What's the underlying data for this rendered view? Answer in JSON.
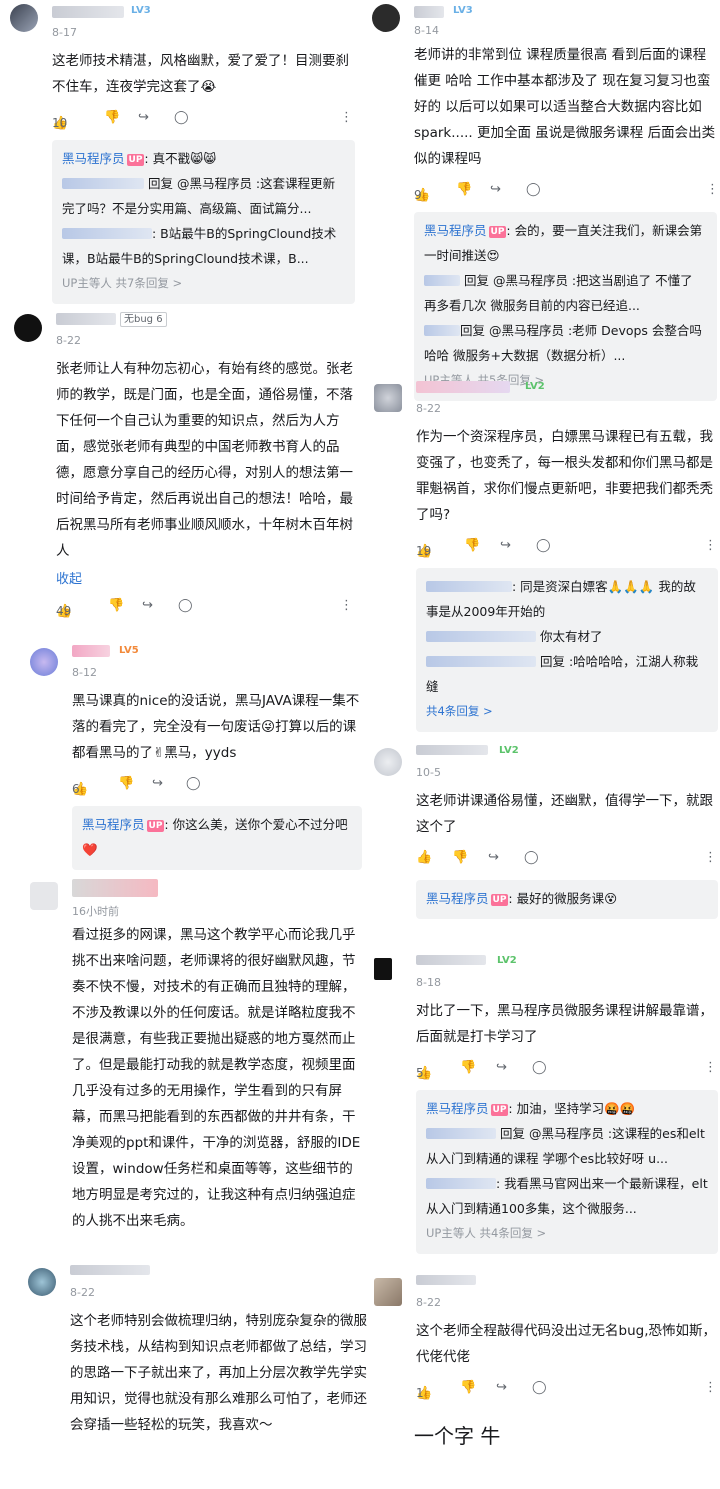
{
  "comments": [
    {
      "date": "8-17",
      "level": "LV3",
      "text": "这老师技术精湛，风格幽默，爱了爱了！目测要刹不住车，连夜学完这套了😭",
      "likes": "10",
      "replies": [
        {
          "who": "黑马程序员",
          "up": "UP",
          "text": ": 真不戳😸😸"
        },
        {
          "who": "",
          "text": "回复 @黑马程序员 :这套课程更新完了吗？不是分实用篇、高级篇、面试篇分..."
        },
        {
          "who": "",
          "text": ": B站最牛B的SpringClound技术课，B站最牛B的SpringClound技术课，B..."
        }
      ],
      "more": "UP主等人 共7条回复 >"
    },
    {
      "date": "8-22",
      "badge": "无bug 6",
      "text": "张老师让人有种勿忘初心，有始有终的感觉。张老师的教学，既是门面，也是全面，通俗易懂，不落下任何一个自己认为重要的知识点，然后为人方面，感觉张老师有典型的中国老师教书育人的品德，愿意分享自己的经历心得，对别人的想法第一时间给予肯定，然后再说出自己的想法！哈哈，最后祝黑马所有老师事业顺风顺水，十年树木百年树人",
      "collapse": "收起",
      "likes": "49"
    },
    {
      "date": "8-12",
      "level": "LV5",
      "text": "黑马课真的nice的没话说，黑马JAVA课程一集不落的看完了，完全没有一句废话😜打算以后的课都看黑马的了✌黑马，yyds",
      "likes": "6",
      "replies": [
        {
          "who": "黑马程序员",
          "up": "UP",
          "text": ": 你这么美，送你个爱心不过分吧❤️"
        }
      ]
    },
    {
      "date": "16小时前",
      "text": "看过挺多的网课，黑马这个教学平心而论我几乎挑不出来啥问题，老师课将的很好幽默风趣，节奏不快不慢，对技术的有正确而且独特的理解，不涉及教课以外的任何废话。就是详略粒度我不是很满意，有些我正要抛出疑惑的地方戛然而止了。但是最能打动我的就是教学态度，视频里面几乎没有过多的无用操作，学生看到的只有屏幕，而黑马把能看到的东西都做的井井有条，干净美观的ppt和课件，干净的浏览器，舒服的IDE设置，window任务栏和桌面等等，这些细节的地方明显是考究过的，让我这种有点归纳强迫症的人挑不出来毛病。"
    },
    {
      "date": "8-22",
      "text": "这个老师特别会做梳理归纳，特别庞杂复杂的微服务技术栈，从结构到知识点老师都做了总结，学习的思路一下子就出来了，再加上分层次教学先学实用知识，觉得也就没有那么难那么可怕了，老师还会穿插一些轻松的玩笑，我喜欢～"
    },
    {
      "date": "8-14",
      "level": "LV3",
      "text": "老师讲的非常到位 课程质量很高 看到后面的课程 催更 哈哈 工作中基本都涉及了 现在复习复习也蛮好的 以后可以如果可以适当整合大数据内容比如 spark..... 更加全面 虽说是微服务课程 后面会出类似的课程吗",
      "likes": "9",
      "replies": [
        {
          "who": "黑马程序员",
          "up": "UP",
          "text": ": 会的，要一直关注我们，新课会第一时间推送😍"
        },
        {
          "who": "",
          "text": "回复 @黑马程序员 :把这当剧追了 不懂了 再多看几次 微服务目前的内容已经追..."
        },
        {
          "who": "",
          "text": "回复 @黑马程序员 :老师 Devops 会整合吗 哈哈 微服务+大数据（数据分析）..."
        }
      ],
      "more": "UP主等人 共5条回复 >"
    },
    {
      "date": "8-22",
      "level": "LV2",
      "text": "作为一个资深程序员，白嫖黑马课程已有五载，我变强了，也变秃了，每一根头发都和你们黑马都是罪魁祸首，求你们慢点更新吧，非要把我们都秃秃了吗?",
      "likes": "19",
      "replies": [
        {
          "who": "",
          "text": ": 同是资深白嫖客🙏🙏🙏 我的故事是从2009年开始的"
        },
        {
          "who": "",
          "text": "你太有材了"
        },
        {
          "who": "",
          "text": "回复 :哈哈哈哈，江湖人称栽缝"
        }
      ],
      "more": "共4条回复 >"
    },
    {
      "date": "10-5",
      "level": "LV2",
      "text": "这老师讲课通俗易懂，还幽默，值得学一下，就跟这个了",
      "likes": "",
      "replies": [
        {
          "who": "黑马程序员",
          "up": "UP",
          "text": ": 最好的微服务课😵"
        }
      ]
    },
    {
      "date": "8-18",
      "level": "LV2",
      "text": "对比了一下，黑马程序员微服务课程讲解最靠谱，后面就是打卡学习了",
      "likes": "5",
      "replies": [
        {
          "who": "黑马程序员",
          "up": "UP",
          "text": ": 加油，坚持学习🤬🤬"
        },
        {
          "who": "",
          "text": "回复 @黑马程序员 :这课程的es和elt从入门到精通的课程 学哪个es比较好呀 u..."
        },
        {
          "who": "",
          "text": ": 我看黑马官网出来一个最新课程，elt从入门到精通100多集，这个微服务..."
        }
      ],
      "more": "UP主等人 共4条回复 >"
    },
    {
      "date": "8-22",
      "text": "这个老师全程敲得代码没出过无名bug,恐怖如斯，代佬代佬",
      "likes": "1"
    }
  ],
  "footer_text": "一个字 牛",
  "icons": {
    "like": "thumbs-up-icon",
    "dislike": "thumbs-down-icon",
    "share": "share-icon",
    "reply": "comment-icon",
    "more": "more-dots-icon"
  }
}
